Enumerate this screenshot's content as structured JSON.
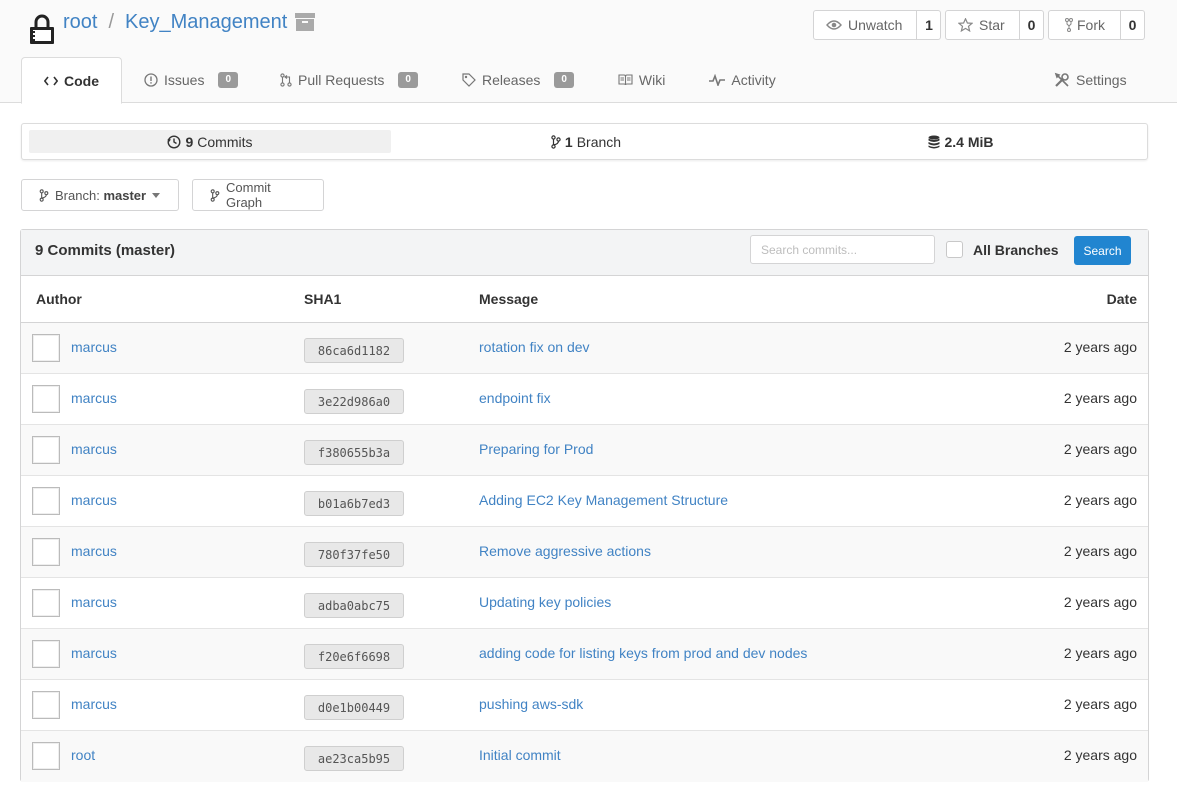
{
  "repo": {
    "owner": "root",
    "name": "Key_Management",
    "separator": "/"
  },
  "actions": {
    "watch": {
      "label": "Unwatch",
      "count": "1"
    },
    "star": {
      "label": "Star",
      "count": "0"
    },
    "fork": {
      "label": "Fork",
      "count": "0"
    }
  },
  "tabs": [
    {
      "label": "Code"
    },
    {
      "label": "Issues",
      "badge": "0"
    },
    {
      "label": "Pull Requests",
      "badge": "0"
    },
    {
      "label": "Releases",
      "badge": "0"
    },
    {
      "label": "Wiki"
    },
    {
      "label": "Activity"
    }
  ],
  "settings": {
    "label": "Settings"
  },
  "stats": {
    "commits": {
      "count": "9",
      "label": "Commits"
    },
    "branches": {
      "count": "1",
      "label": "Branch"
    },
    "size": {
      "value": "2.4 MiB"
    }
  },
  "branch_selector": {
    "prefix": "Branch:",
    "value": "master"
  },
  "commit_graph": {
    "label": "Commit Graph"
  },
  "commits_panel": {
    "title": "9 Commits (master)",
    "search_placeholder": "Search commits...",
    "all_branches_label": "All Branches",
    "search_button": "Search",
    "columns": {
      "author": "Author",
      "sha": "SHA1",
      "message": "Message",
      "date": "Date"
    },
    "rows": [
      {
        "author": "marcus",
        "sha": "86ca6d1182",
        "message": "rotation fix on dev",
        "date": "2 years ago"
      },
      {
        "author": "marcus",
        "sha": "3e22d986a0",
        "message": "endpoint fix",
        "date": "2 years ago"
      },
      {
        "author": "marcus",
        "sha": "f380655b3a",
        "message": "Preparing for Prod",
        "date": "2 years ago"
      },
      {
        "author": "marcus",
        "sha": "b01a6b7ed3",
        "message": "Adding EC2 Key Management Structure",
        "date": "2 years ago"
      },
      {
        "author": "marcus",
        "sha": "780f37fe50",
        "message": "Remove aggressive actions",
        "date": "2 years ago"
      },
      {
        "author": "marcus",
        "sha": "adba0abc75",
        "message": "Updating key policies",
        "date": "2 years ago"
      },
      {
        "author": "marcus",
        "sha": "f20e6f6698",
        "message": "adding code for listing keys from prod and dev nodes",
        "date": "2 years ago"
      },
      {
        "author": "marcus",
        "sha": "d0e1b00449",
        "message": "pushing aws-sdk",
        "date": "2 years ago"
      },
      {
        "author": "root",
        "sha": "ae23ca5b95",
        "message": "Initial commit",
        "date": "2 years ago"
      }
    ]
  },
  "colors": {
    "link": "#4183c4",
    "primary_button": "#2185d0",
    "badge": "#9a9a9a"
  },
  "icons": [
    "lock-icon",
    "archive-icon",
    "eye-icon",
    "star-icon",
    "fork-icon",
    "code-icon",
    "issue-icon",
    "pull-request-icon",
    "tag-icon",
    "book-icon",
    "pulse-icon",
    "tools-icon",
    "history-icon",
    "branch-icon",
    "database-icon",
    "caret-down-icon"
  ]
}
